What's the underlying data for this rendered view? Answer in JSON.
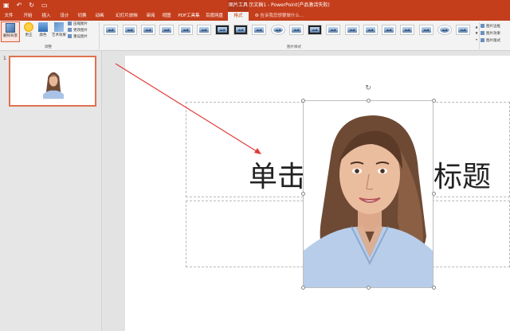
{
  "qat": {
    "save_icon": "save-icon",
    "undo_icon": "undo-icon",
    "redo_icon": "redo-icon",
    "start_icon": "present-icon"
  },
  "title_bar": {
    "context_tab_title": "图片工具",
    "document_title": "演示文稿1 - PowerPoint(产品激活失败)"
  },
  "tabs": [
    {
      "label": "文件"
    },
    {
      "label": "开始"
    },
    {
      "label": "插入"
    },
    {
      "label": "设计"
    },
    {
      "label": "切换"
    },
    {
      "label": "动画"
    },
    {
      "label": "幻灯片放映"
    },
    {
      "label": "审阅"
    },
    {
      "label": "视图"
    },
    {
      "label": "PDF工具集"
    },
    {
      "label": "百度网盘"
    },
    {
      "label": "格式"
    }
  ],
  "tell_me": "告诉我您想要做什么...",
  "ribbon": {
    "remove_bg": "删除背景",
    "corrections": "更正",
    "color": "颜色",
    "artistic": "艺术效果",
    "compress": "压缩图片",
    "change": "更改图片",
    "reset": "重设图片",
    "group_adjust": "调整",
    "group_styles": "图片样式",
    "border": "图片边框",
    "effects": "图片效果",
    "layout": "图片版式"
  },
  "thumbnail": {
    "number": "1"
  },
  "slide": {
    "title_left": "单击",
    "title_right": "标题"
  },
  "colors": {
    "accent": "#c43e1c",
    "tab_active_text": "#c43e1c",
    "arrow": "#e03a3a",
    "selection_border": "#e05a3a"
  }
}
